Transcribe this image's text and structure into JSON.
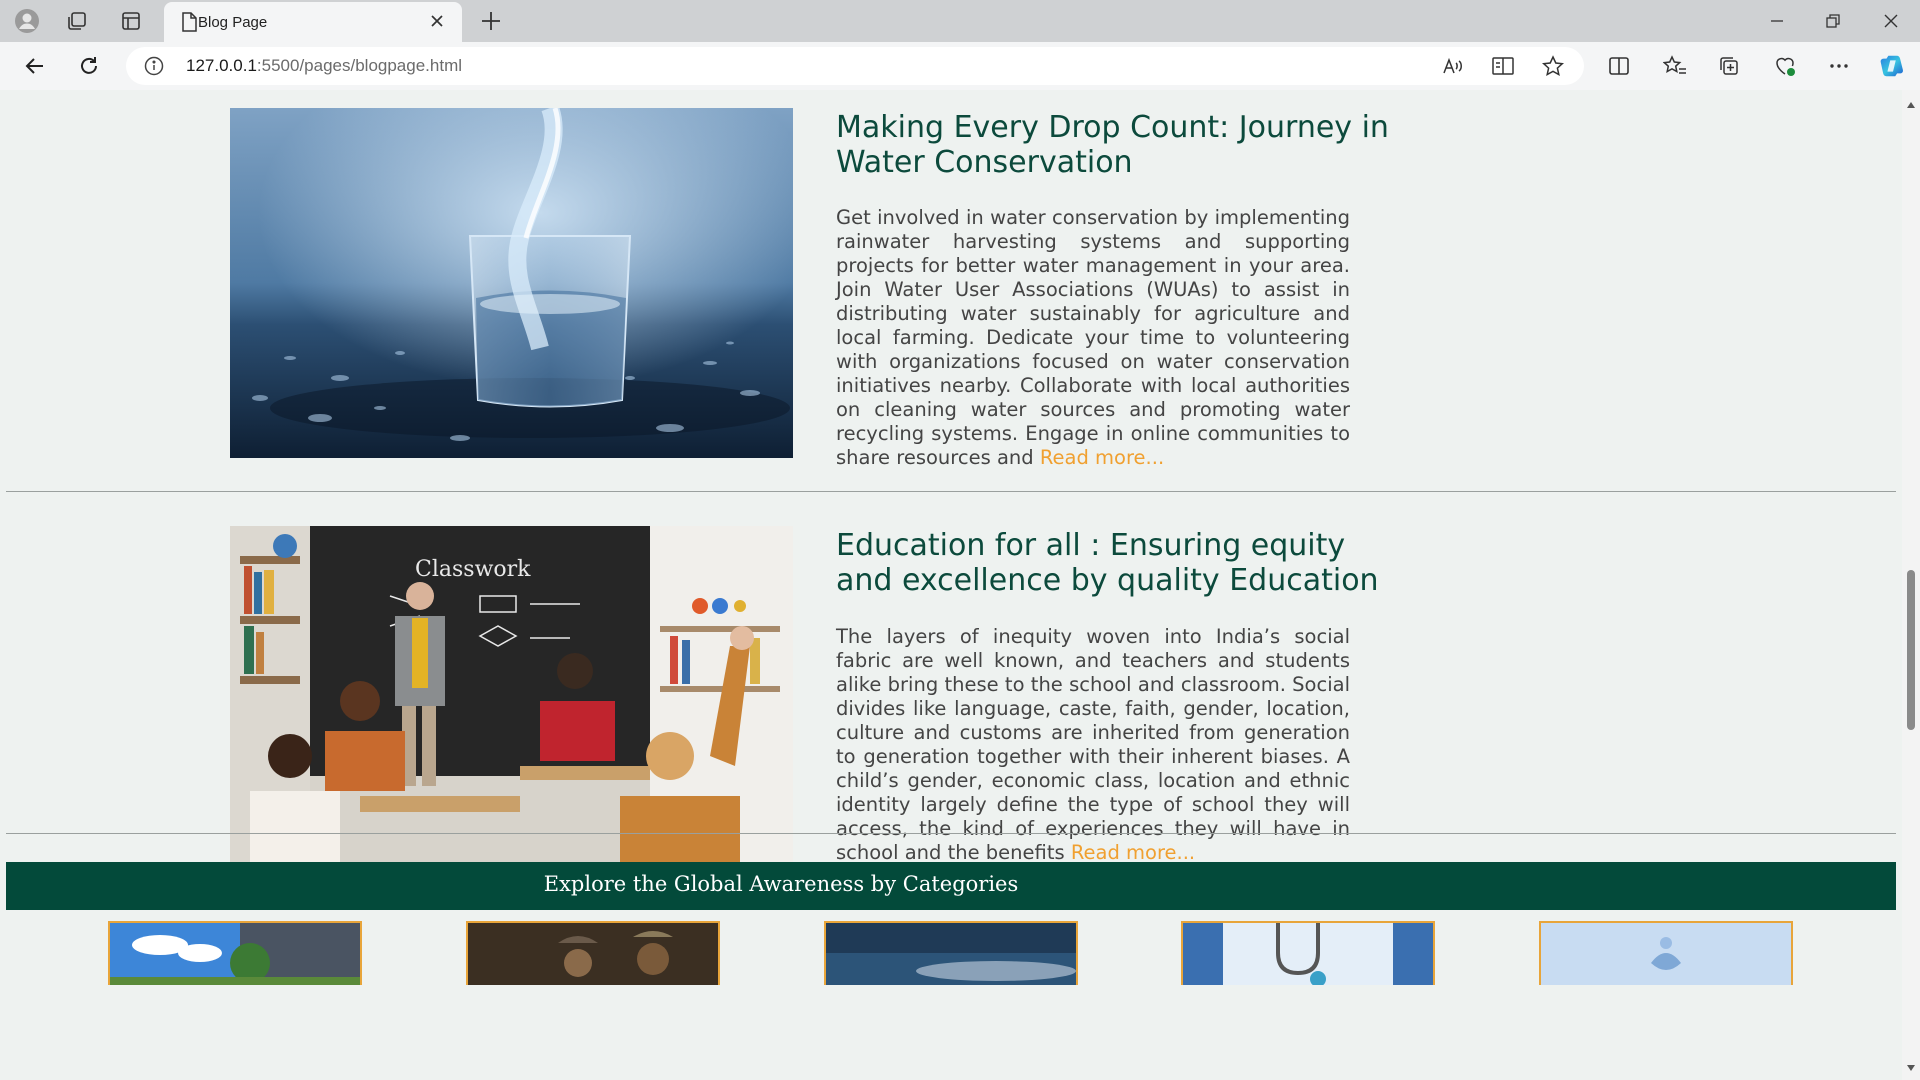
{
  "browser": {
    "tab_title": "Blog Page",
    "url_host": "127.0.0.1",
    "url_rest": ":5500/pages/blogpage.html"
  },
  "posts": [
    {
      "title": "Making Every Drop Count: Journey in Water Conservation",
      "body": "Get involved in water conservation by implementing rainwater harvesting systems and supporting projects for better water management in your area. Join Water User Associations (WUAs) to assist in distributing water sustainably for agriculture and local farming. Dedicate your time to volunteering with organizations focused on water conservation initiatives nearby. Collaborate with local authorities on cleaning water sources and promoting water recycling systems. Engage in online communities to share resources and ",
      "read_more": "Read more..."
    },
    {
      "title": "Education for all : Ensuring equity and excellence by quality Education",
      "body": "The layers of inequity woven into India’s social fabric are well known, and teachers and students alike bring these to the school and classroom. Social divides like language, caste, faith, gender, location, culture and customs are inherited from generation to generation together with their inherent biases. A child’s gender, economic class, location and ethnic identity largely define the type of school they will access, the kind of experiences they will have in school and the benefits ",
      "read_more": "Read more..."
    }
  ],
  "categories": {
    "title": "Explore the Global Awareness by Categories"
  },
  "colors": {
    "accent_link": "#f0a030",
    "title_green": "#0c4a3c",
    "banner_green": "#034a3a",
    "card_border": "#e8a53a"
  }
}
